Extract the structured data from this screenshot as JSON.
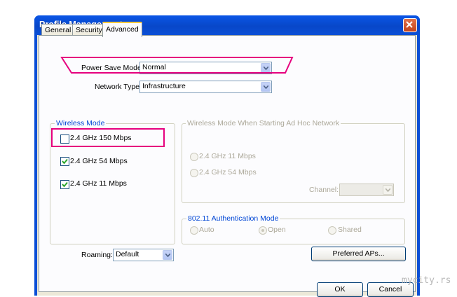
{
  "window": {
    "title": "Profile Management"
  },
  "tabs": [
    {
      "label": "General",
      "active": false
    },
    {
      "label": "Security",
      "active": false
    },
    {
      "label": "Advanced",
      "active": true
    }
  ],
  "power_save": {
    "label": "Power Save Mode:",
    "value": "Normal"
  },
  "network_type": {
    "label": "Network Type:",
    "value": "Infrastructure"
  },
  "wireless_mode": {
    "title": "Wireless Mode",
    "options": [
      {
        "label": "2.4 GHz 150 Mbps",
        "checked": false
      },
      {
        "label": "2.4 GHz 54 Mbps",
        "checked": true
      },
      {
        "label": "2.4 GHz 11 Mbps",
        "checked": true
      }
    ]
  },
  "adhoc_mode": {
    "title": "Wireless Mode When Starting Ad Hoc Network",
    "options": [
      {
        "label": "2.4 GHz 11 Mbps",
        "selected": false
      },
      {
        "label": "2.4 GHz 54 Mbps",
        "selected": false
      }
    ],
    "channel_label": "Channel:",
    "channel_value": ""
  },
  "auth_mode": {
    "title": "802.11 Authentication Mode",
    "options": [
      {
        "label": "Auto",
        "selected": false
      },
      {
        "label": "Open",
        "selected": true
      },
      {
        "label": "Shared",
        "selected": false
      }
    ]
  },
  "roaming": {
    "label": "Roaming:",
    "value": "Default"
  },
  "buttons": {
    "preferred_aps": "Preferred APs...",
    "ok": "OK",
    "cancel": "Cancel"
  },
  "watermark": "mycity.rs",
  "colors": {
    "title_bar": "#0a4fd6",
    "highlight": "#e6007e",
    "group_title": "#0046d5"
  }
}
